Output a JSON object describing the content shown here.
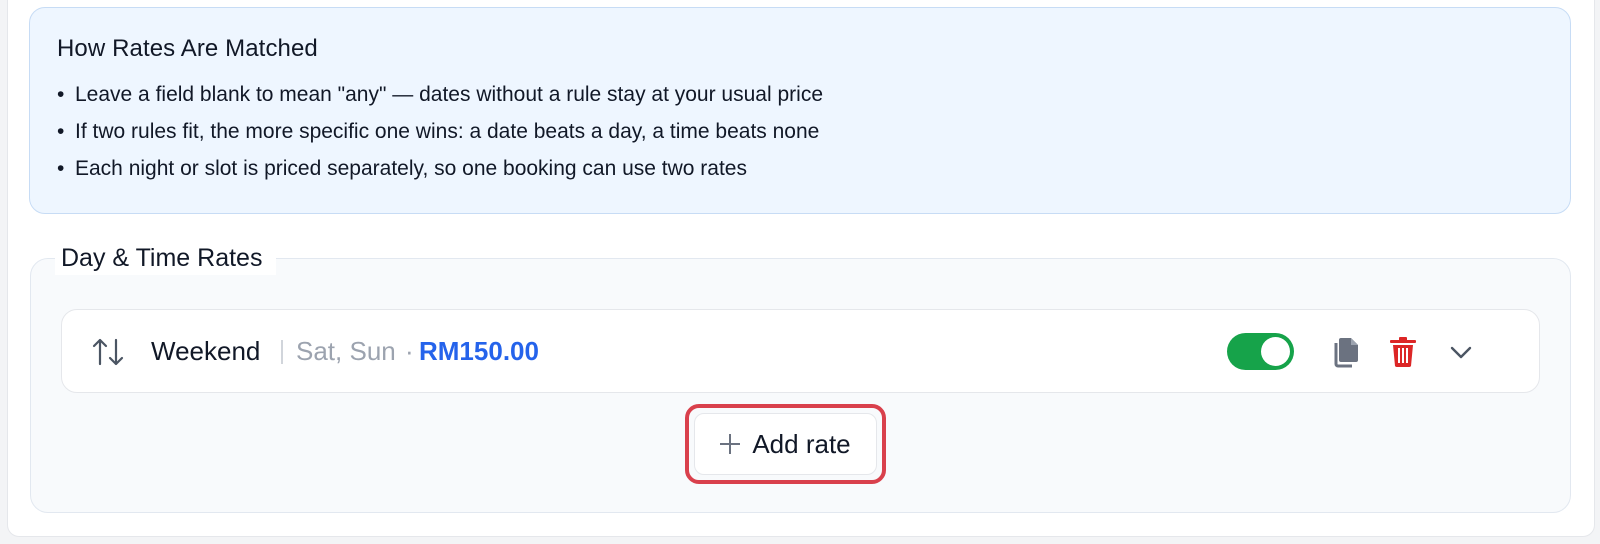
{
  "info": {
    "title": "How Rates Are Matched",
    "bullet": "•",
    "items": [
      "Leave a field blank to mean \"any\" — dates without a rule stay at your usual price",
      "If two rules fit, the more specific one wins: a date beats a day, a time beats none",
      "Each night or slot is priced separately, so one booking can use two rates"
    ]
  },
  "rates_section": {
    "legend": "Day & Time Rates",
    "rows": [
      {
        "name": "Weekend",
        "days": "Sat, Sun",
        "dot": "·",
        "price": "RM150.00",
        "enabled": true
      }
    ],
    "add_label": "Add rate"
  },
  "colors": {
    "accent_blue": "#2563eb",
    "toggle_on": "#16a34a",
    "delete_red": "#dc2626",
    "highlight_outline": "#d9404c"
  },
  "icons": {
    "sort": "sort-arrows-icon",
    "copy": "copy-icon",
    "delete": "trash-icon",
    "expand": "chevron-down-icon",
    "add": "plus-icon"
  }
}
